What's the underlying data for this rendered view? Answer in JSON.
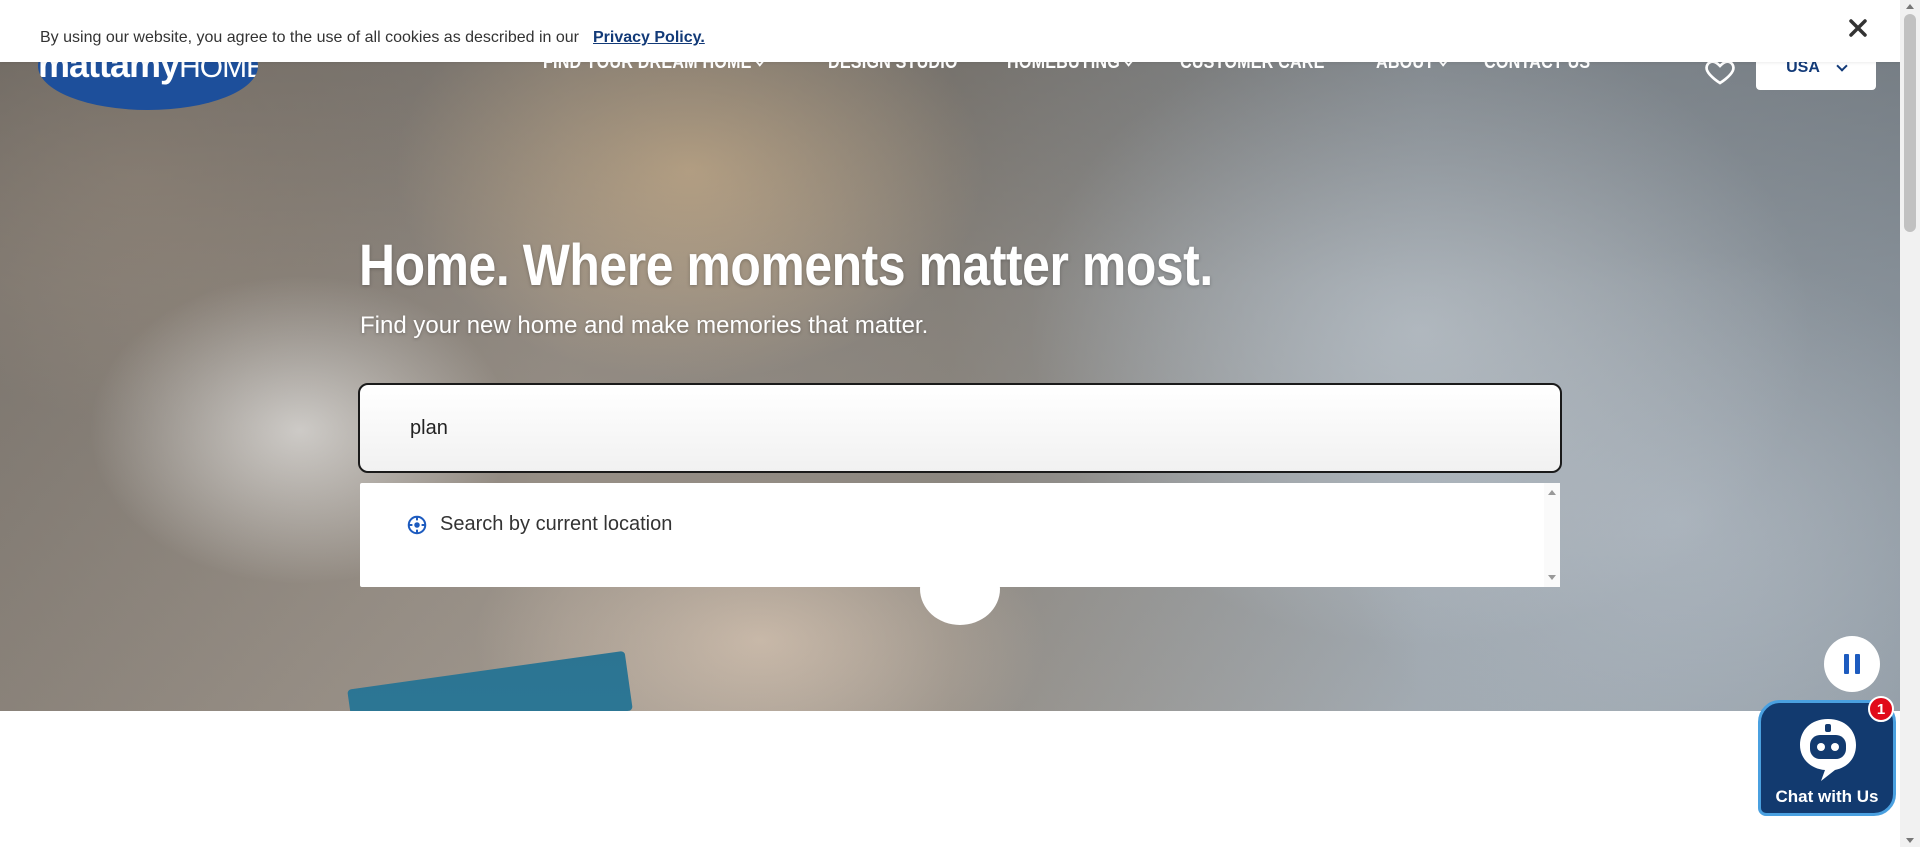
{
  "cookie_banner": {
    "text": "By using our website, you agree to the use of all cookies as described in our",
    "link_label": "Privacy Policy.",
    "close_icon": "close-icon"
  },
  "header": {
    "logo": {
      "main": "mattamy",
      "suffix": "HOMES"
    },
    "nav": [
      {
        "label": "FIND YOUR DREAM HOME",
        "has_dropdown": true
      },
      {
        "label": "DESIGN STUDIO",
        "has_dropdown": false
      },
      {
        "label": "HOMEBUYING",
        "has_dropdown": true
      },
      {
        "label": "CUSTOMER CARE",
        "has_dropdown": false
      },
      {
        "label": "ABOUT",
        "has_dropdown": true
      },
      {
        "label": "CONTACT US",
        "has_dropdown": false
      }
    ],
    "favorites_icon": "heart-icon",
    "country_selector": {
      "value": "USA"
    }
  },
  "hero": {
    "headline": "Home. Where moments matter most.",
    "subheadline": "Find your new home and make memories that matter."
  },
  "search": {
    "value": "plan",
    "suggestions": [
      {
        "label": "Search by current location",
        "icon": "location-crosshair-icon"
      }
    ]
  },
  "controls": {
    "pause_icon": "pause-icon"
  },
  "chat_widget": {
    "label": "Chat with Us",
    "badge_count": "1",
    "icon": "chatbot-icon"
  },
  "colors": {
    "brand_blue": "#1d4f9b",
    "navy": "#123a78",
    "chat_bg": "#123a6f",
    "badge_red": "#e10a1a"
  }
}
